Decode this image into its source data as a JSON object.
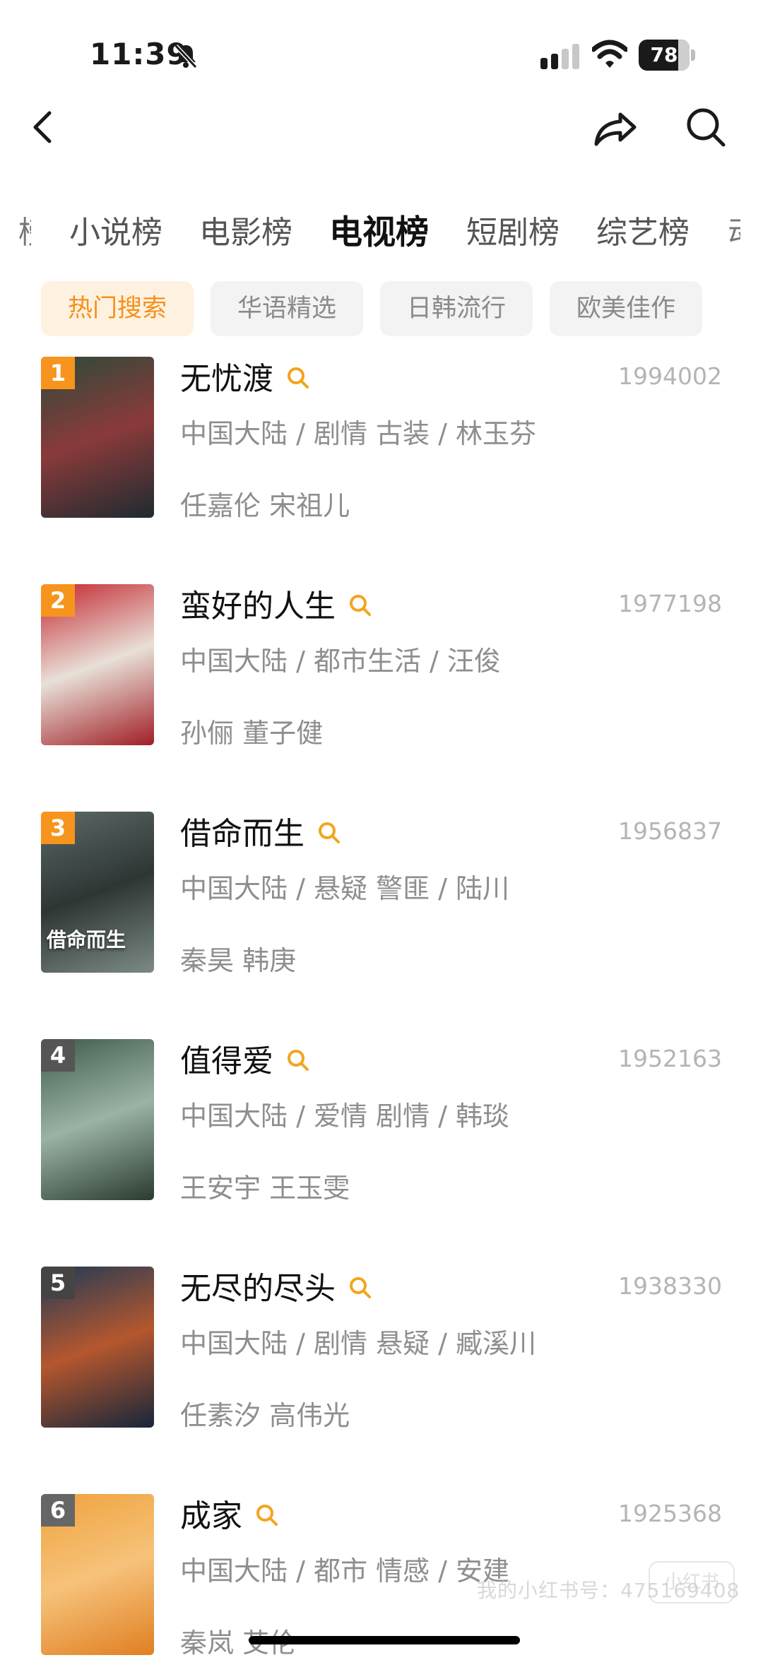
{
  "status_bar": {
    "time": "11:39",
    "battery": "78",
    "battery_level": 0.78
  },
  "nav": {
    "back_icon": "chevron-left-icon",
    "share_icon": "share-arrow-icon",
    "search_icon": "search-icon"
  },
  "category_tabs": {
    "items": [
      "小说榜",
      "电影榜",
      "电视榜",
      "短剧榜",
      "综艺榜"
    ],
    "active": "电视榜"
  },
  "filter_chips": {
    "items": [
      "热门搜索",
      "华语精选",
      "日韩流行",
      "欧美佳作"
    ],
    "active": "热门搜索"
  },
  "ranking": [
    {
      "rank": "1",
      "title": "无忧渡",
      "score": "1994002",
      "meta": "中国大陆 / 剧情 古装 / 林玉芬",
      "cast": "任嘉伦 宋祖儿",
      "badge_color": "#f7941d",
      "poster_colors": [
        "#2c4a3a",
        "#8a3a3a",
        "#1e2b30"
      ]
    },
    {
      "rank": "2",
      "title": "蛮好的人生",
      "score": "1977198",
      "meta": "中国大陆 / 都市生活 / 汪俊",
      "cast": "孙俪 董子健",
      "badge_color": "#f7941d",
      "poster_colors": [
        "#c4262f",
        "#e8e0d8",
        "#a01e25"
      ]
    },
    {
      "rank": "3",
      "title": "借命而生",
      "score": "1956837",
      "meta": "中国大陆 / 悬疑 警匪 / 陆川",
      "cast": "秦昊 韩庚",
      "badge_color": "#f7941d",
      "poster_colors": [
        "#5b6a68",
        "#2e3634",
        "#7c8a86"
      ],
      "poster_title": "借命而生"
    },
    {
      "rank": "4",
      "title": "值得爱",
      "score": "1952163",
      "meta": "中国大陆 / 爱情 剧情 / 韩琰",
      "cast": "王安宇 王玉雯",
      "badge_color": "#555555",
      "poster_colors": [
        "#3f5a4c",
        "#9ab3a4",
        "#2a3a30"
      ]
    },
    {
      "rank": "5",
      "title": "无尽的尽头",
      "score": "1938330",
      "meta": "中国大陆 / 剧情 悬疑 / 臧溪川",
      "cast": "任素汐 高伟光",
      "badge_color": "#444444",
      "poster_colors": [
        "#1f3a56",
        "#b5572e",
        "#16263a"
      ]
    },
    {
      "rank": "6",
      "title": "成家",
      "score": "1925368",
      "meta": "中国大陆 / 都市 情感 / 安建",
      "cast": "秦岚 艾伦",
      "badge_color": "#666666",
      "poster_colors": [
        "#f0a33e",
        "#f6c27a",
        "#e07f22"
      ]
    }
  ],
  "watermark": {
    "text": "我的小红书号：475169408",
    "logo": "小红书"
  },
  "accent_color": "#f2921d"
}
